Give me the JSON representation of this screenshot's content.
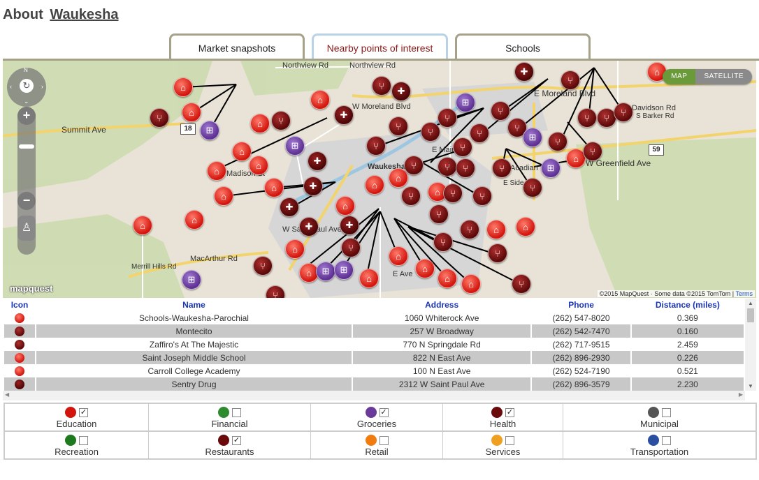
{
  "header": {
    "about": "About",
    "city": "Waukesha"
  },
  "tabs": [
    "Market snapshots",
    "Nearby points of interest",
    "Schools"
  ],
  "map": {
    "type_buttons": [
      "MAP",
      "SATELLITE"
    ],
    "active_type": "MAP",
    "logo": "mapquest",
    "attribution": "©2015 MapQuest · Some data ©2015 TomTom |",
    "terms": "Terms",
    "compass": "N",
    "labels": [
      "Northview Rd",
      "Northview Rd",
      "Summit Ave",
      "W Moreland Blvd",
      "E Moreland Blvd",
      "W Greenfield Ave",
      "Acadian",
      "Waukesha",
      "Madison St",
      "W Saint Paul Ave",
      "MacArthur Rd",
      "Merrill Hills Rd",
      "E Main St",
      "E Ave",
      "E Side Byp",
      "S Barker Rd",
      "Davidson Rd"
    ],
    "route_signs": [
      "18",
      "59"
    ]
  },
  "table": {
    "headers": [
      "Icon",
      "Name",
      "Address",
      "Phone",
      "Distance (miles)"
    ],
    "rows": [
      {
        "icon": "education",
        "name": "Schools-Waukesha-Parochial",
        "address": "1060 Whiterock Ave",
        "phone": "(262) 547-8020",
        "distance": "0.369"
      },
      {
        "icon": "restaurant",
        "name": "Montecito",
        "address": "257 W Broadway",
        "phone": "(262) 542-7470",
        "distance": "0.160"
      },
      {
        "icon": "restaurant",
        "name": "Zaffiro's At The Majestic",
        "address": "770 N Springdale Rd",
        "phone": "(262) 717-9515",
        "distance": "2.459"
      },
      {
        "icon": "education",
        "name": "Saint Joseph Middle School",
        "address": "822 N East Ave",
        "phone": "(262) 896-2930",
        "distance": "0.226"
      },
      {
        "icon": "education",
        "name": "Carroll College Academy",
        "address": "100 N East Ave",
        "phone": "(262) 524-7190",
        "distance": "0.521"
      },
      {
        "icon": "health",
        "name": "Sentry Drug",
        "address": "2312 W Saint Paul Ave",
        "phone": "(262) 896-3579",
        "distance": "2.230"
      }
    ]
  },
  "legend": [
    {
      "label": "Education",
      "checked": true,
      "color": "#d2140c"
    },
    {
      "label": "Financial",
      "checked": false,
      "color": "#2e8b2e"
    },
    {
      "label": "Groceries",
      "checked": true,
      "color": "#6a3a9a"
    },
    {
      "label": "Health",
      "checked": true,
      "color": "#6a0a0a"
    },
    {
      "label": "Municipal",
      "checked": false,
      "color": "#555555"
    },
    {
      "label": "Recreation",
      "checked": false,
      "color": "#1e7a1e"
    },
    {
      "label": "Restaurants",
      "checked": true,
      "color": "#6a0a0a"
    },
    {
      "label": "Retail",
      "checked": false,
      "color": "#f07c10"
    },
    {
      "label": "Services",
      "checked": false,
      "color": "#f0a020"
    },
    {
      "label": "Transportation",
      "checked": false,
      "color": "#2a4fa0"
    }
  ]
}
